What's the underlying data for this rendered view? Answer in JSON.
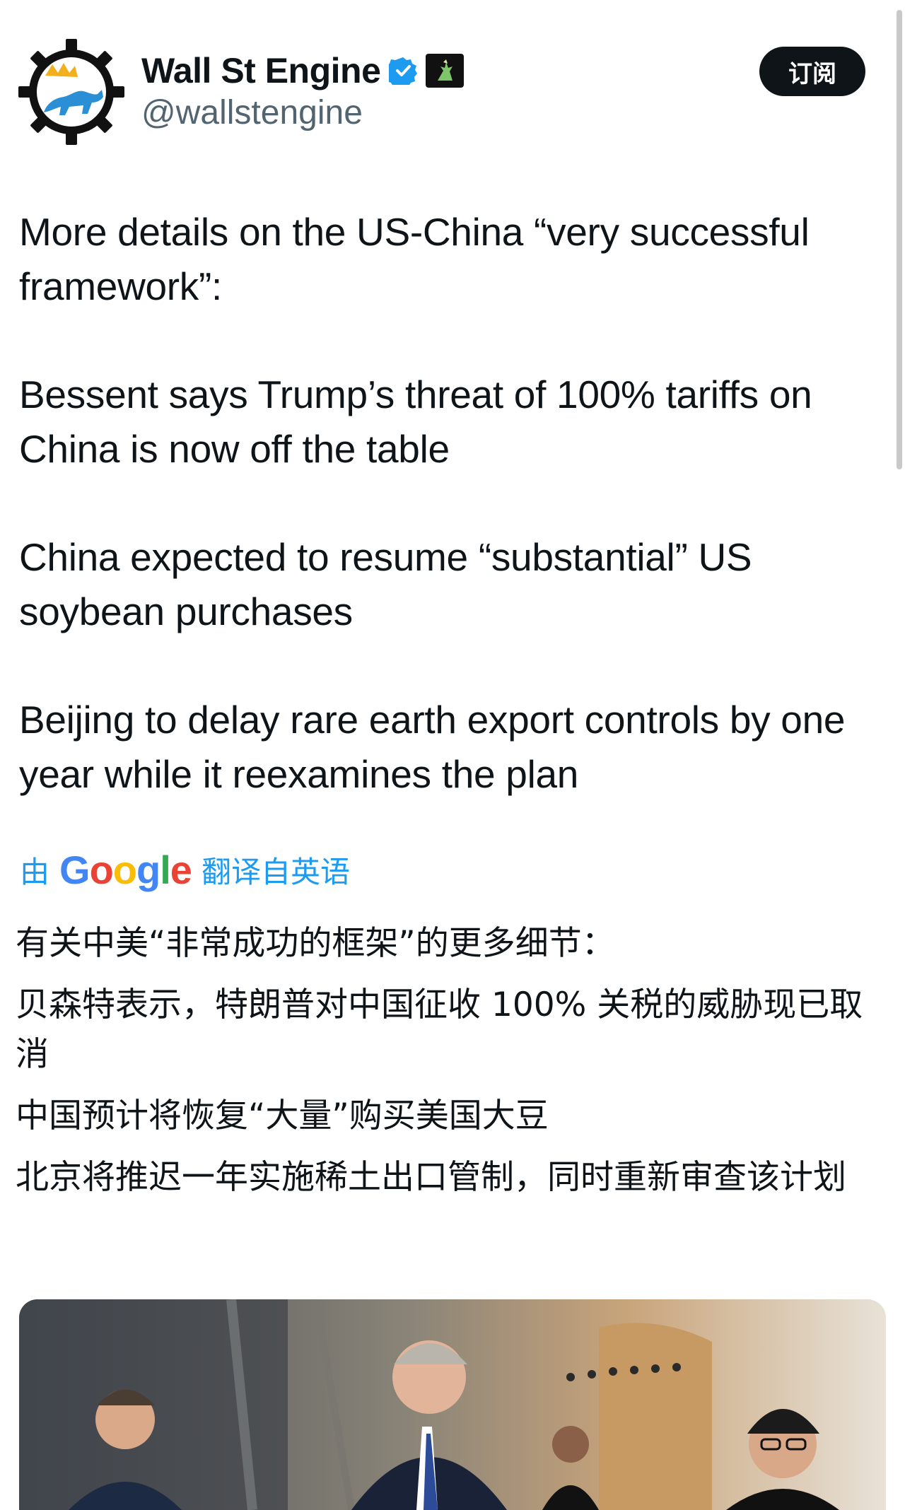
{
  "author": {
    "display_name": "Wall St Engine",
    "handle": "@wallstengine"
  },
  "subscribe_label": "订阅",
  "tweet": {
    "paragraphs": [
      "More details on the US-China “very successful framework”:",
      "Bessent says Trump’s threat of 100% tariffs on China is now off the table",
      "China expected to resume “substantial” US soybean purchases",
      "Beijing to delay rare earth export controls by one year while it reexamines the plan"
    ]
  },
  "translation": {
    "prefix": "由",
    "provider": "Google",
    "suffix": "翻译自英语",
    "paragraphs": [
      "有关中美“非常成功的框架”的更多细节：",
      "贝森特表示，特朗普对中国征收 100% 关税的威胁现已取消",
      "中国预计将恢复“大量”购买美国大豆",
      "北京将推迟一年实施稀土出口管制，同时重新审查该计划"
    ]
  },
  "icons": {
    "avatar": "bull-gear-logo",
    "verified": "verified-badge-icon",
    "affiliation": "affiliate-badge-icon"
  },
  "colors": {
    "verified_blue": "#1d9bf0",
    "text": "#0f1419",
    "secondary_text": "#536471",
    "button_bg": "#0f1419"
  }
}
